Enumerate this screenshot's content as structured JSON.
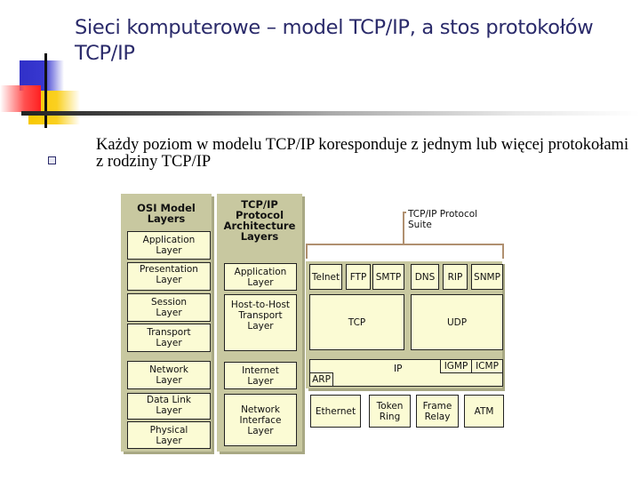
{
  "slide": {
    "title": "Sieci komputerowe – model TCP/IP, a stos protokołów TCP/IP",
    "bullet_icon": "square-bullet-icon",
    "bullet_text": "Każdy poziom w modelu TCP/IP koresponduje z jednym lub więcej protokołami z rodziny TCP/IP"
  },
  "diagram": {
    "osi": {
      "heading": "OSI Model\nLayers",
      "layers": [
        "Application\nLayer",
        "Presentation\nLayer",
        "Session\nLayer",
        "Transport\nLayer",
        "Network\nLayer",
        "Data Link\nLayer",
        "Physical\nLayer"
      ]
    },
    "tcpip": {
      "heading": "TCP/IP\nProtocol\nArchitecture\nLayers",
      "layers": [
        "Application\nLayer",
        "Host-to-Host\nTransport\nLayer",
        "Internet\nLayer",
        "Network\nInterface\nLayer"
      ]
    },
    "suite": {
      "label": "TCP/IP Protocol\nSuite",
      "application": [
        "Telnet",
        "FTP",
        "SMTP",
        "DNS",
        "RIP",
        "SNMP"
      ],
      "transport": [
        "TCP",
        "UDP"
      ],
      "internet": {
        "main": "IP",
        "arp": "ARP",
        "igmp": "IGMP",
        "icmp": "ICMP"
      },
      "network_interface": [
        "Ethernet",
        "Token\nRing",
        "Frame\nRelay",
        "ATM"
      ]
    },
    "colors": {
      "panel": "#c8c8a0",
      "box": "#fbfbd4",
      "bracket": "#b09070",
      "title": "#2a2a6a"
    }
  }
}
